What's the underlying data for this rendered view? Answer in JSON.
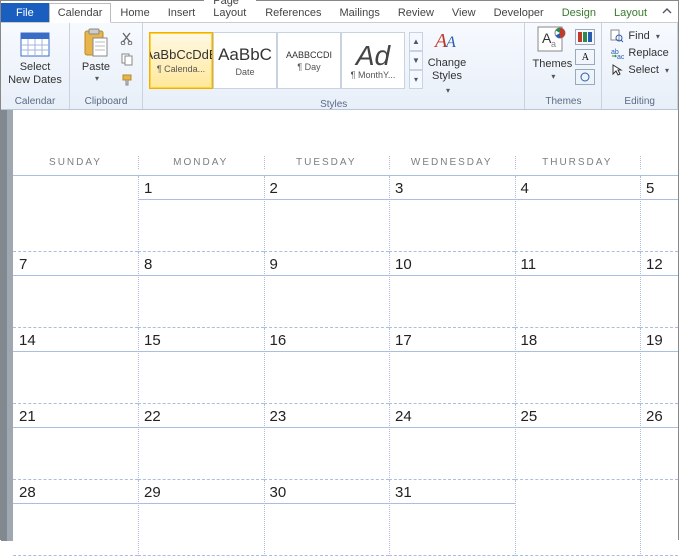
{
  "tabs": {
    "file": "File",
    "items": [
      "Calendar",
      "Home",
      "Insert",
      "Page Layout",
      "References",
      "Mailings",
      "Review",
      "View",
      "Developer"
    ],
    "context": [
      "Design",
      "Layout"
    ],
    "active": "Calendar"
  },
  "ribbon": {
    "calendar": {
      "select_new_dates": "Select\nNew Dates",
      "group": "Calendar"
    },
    "clipboard": {
      "paste": "Paste",
      "group": "Clipboard"
    },
    "styles": {
      "items": [
        {
          "big": "AaBbCcDdE",
          "sm": "¶ Calenda..."
        },
        {
          "big": "AaBbC",
          "sm": "Date"
        },
        {
          "big": "AABBCCDI",
          "sm": "¶ Day"
        },
        {
          "big": "Ad",
          "sm": "¶ MonthY..."
        }
      ],
      "change": "Change\nStyles",
      "group": "Styles"
    },
    "themes": {
      "themes": "Themes",
      "group": "Themes"
    },
    "editing": {
      "find": "Find",
      "replace": "Replace",
      "select": "Select",
      "group": "Editing"
    }
  },
  "calendar": {
    "headers": [
      "SUNDAY",
      "MONDAY",
      "TUESDAY",
      "WEDNESDAY",
      "THURSDAY",
      ""
    ],
    "rows": [
      [
        "",
        "1",
        "2",
        "3",
        "4",
        "5"
      ],
      [
        "7",
        "8",
        "9",
        "10",
        "11",
        "12"
      ],
      [
        "14",
        "15",
        "16",
        "17",
        "18",
        "19"
      ],
      [
        "21",
        "22",
        "23",
        "24",
        "25",
        "26"
      ],
      [
        "28",
        "29",
        "30",
        "31",
        "",
        ""
      ]
    ]
  }
}
